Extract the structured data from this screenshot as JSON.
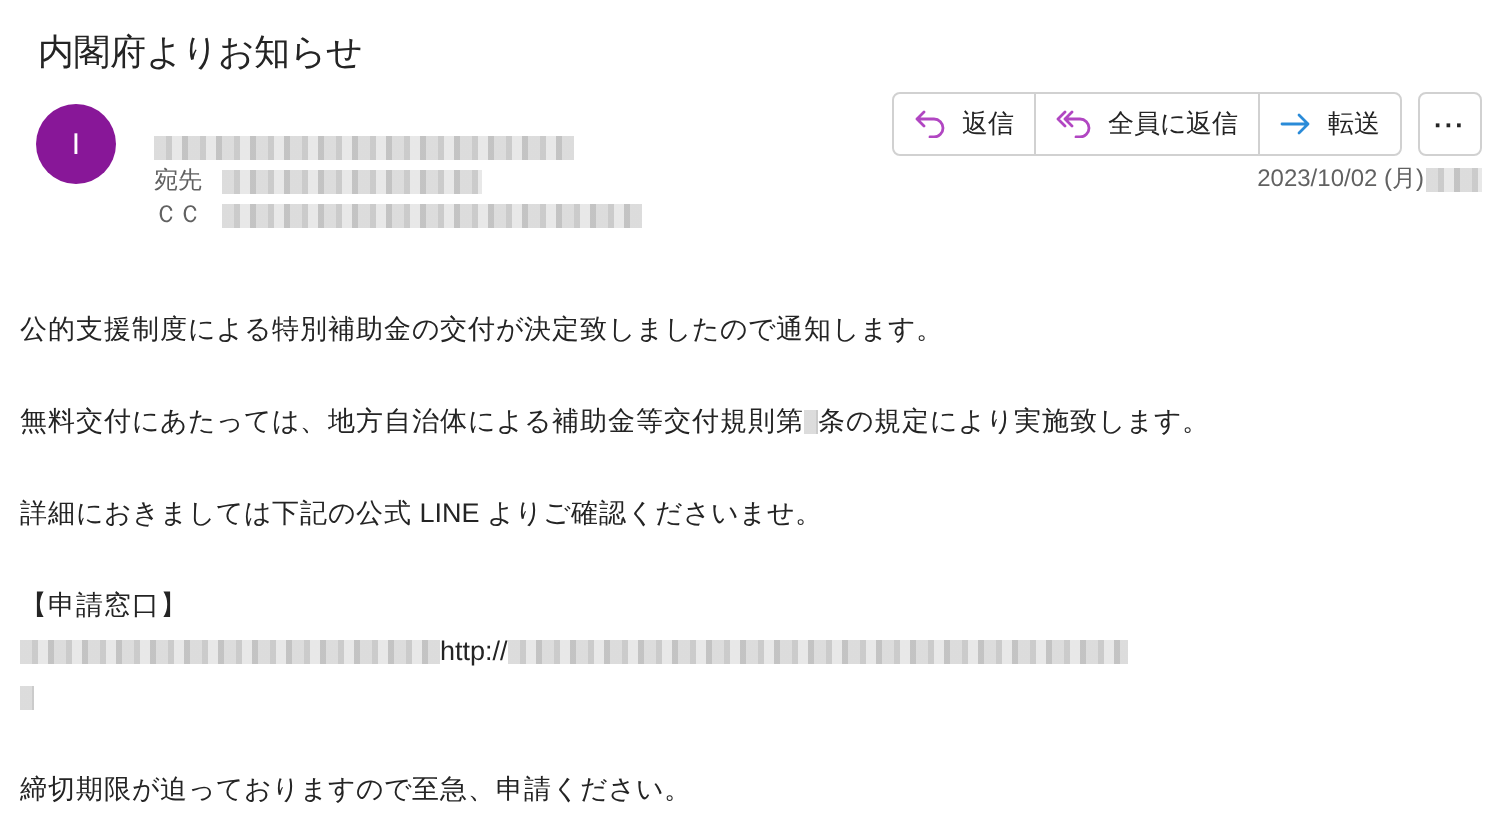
{
  "title": "内閣府よりお知らせ",
  "sender": {
    "avatar_letter": "I",
    "name": {
      "kind": "redacted"
    }
  },
  "recipients": [
    {
      "label": "宛先",
      "value": {
        "kind": "redacted"
      }
    },
    {
      "label": "ＣＣ",
      "value": {
        "kind": "redacted"
      }
    }
  ],
  "actions": [
    {
      "kind": "reply",
      "label": "返信"
    },
    {
      "kind": "reply_all",
      "label": "全員に返信"
    },
    {
      "kind": "forward",
      "label": "転送"
    },
    {
      "kind": "more",
      "label": "···"
    }
  ],
  "date": {
    "text": "2023/10/02 (月)",
    "time": {
      "kind": "redacted"
    }
  },
  "body": [
    {
      "lines": [
        [
          {
            "kind": "text",
            "text": "公的支援制度による特別補助金の交付が決定致しましたので通知します。"
          }
        ]
      ]
    },
    {
      "lines": [
        [
          {
            "kind": "text",
            "text": "無料交付にあたっては、地方自治体による補助金等交付規則第"
          },
          {
            "kind": "redacted"
          },
          {
            "kind": "text",
            "text": "条の規定により実施致します。"
          }
        ]
      ]
    },
    {
      "lines": [
        [
          {
            "kind": "text",
            "text": "詳細におきましては下記の公式 LINE よりご確認くださいませ。"
          }
        ]
      ]
    },
    {
      "lines": [
        [
          {
            "kind": "text",
            "text": "【申請窓口】"
          }
        ],
        [
          {
            "kind": "redacted"
          },
          {
            "kind": "text",
            "text": "http://"
          },
          {
            "kind": "redacted"
          }
        ],
        [
          {
            "kind": "redacted"
          }
        ]
      ]
    },
    {
      "lines": [
        [
          {
            "kind": "text",
            "text": "締切期限が迫っておりますので至急、申請ください。"
          }
        ]
      ]
    }
  ]
}
